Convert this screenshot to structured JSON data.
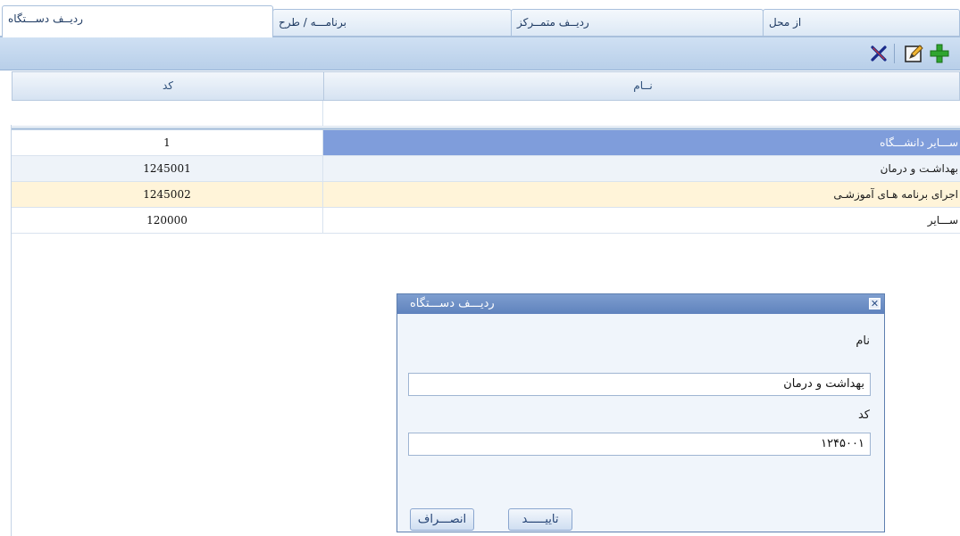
{
  "tabs": [
    {
      "label": "ردیــف دســـتگاه",
      "active": true
    },
    {
      "label": "برنامـــه / طرح",
      "active": false
    },
    {
      "label": "ردیــف متمــرکز",
      "active": false
    },
    {
      "label": "از محل",
      "active": false
    }
  ],
  "toolbar": {
    "icons": [
      "add-icon",
      "edit-icon",
      "delete-icon"
    ],
    "colors": {
      "add": "#2fa52f",
      "delete": "#1b2b8a"
    }
  },
  "grid": {
    "columns": {
      "name": "نــام",
      "code": "کد"
    },
    "rows": [
      {
        "name": "ســـایر دانشـــگاه",
        "code": "1",
        "state": "selected"
      },
      {
        "name": "بهداشـت و درمان",
        "code": "1245001",
        "state": "stripe"
      },
      {
        "name": "اجرای برنامه هـای آموزشـی",
        "code": "1245002",
        "state": "hover"
      },
      {
        "name": "ســـایر",
        "code": "120000",
        "state": "normal"
      }
    ]
  },
  "dialog": {
    "title": "ردیـــف دســـتگاه",
    "name_label": "نام",
    "name_value": "بهداشت و درمان",
    "code_label": "کد",
    "code_value": "۱۲۴۵۰۰۱",
    "ok_label": "تاییـــــد",
    "cancel_label": "انصـــراف",
    "close_glyph": "✕"
  },
  "colors": {
    "selected_row": "#7f9ddb",
    "hover_row": "#fff4d9",
    "title_bar": "#6a8cc6"
  }
}
